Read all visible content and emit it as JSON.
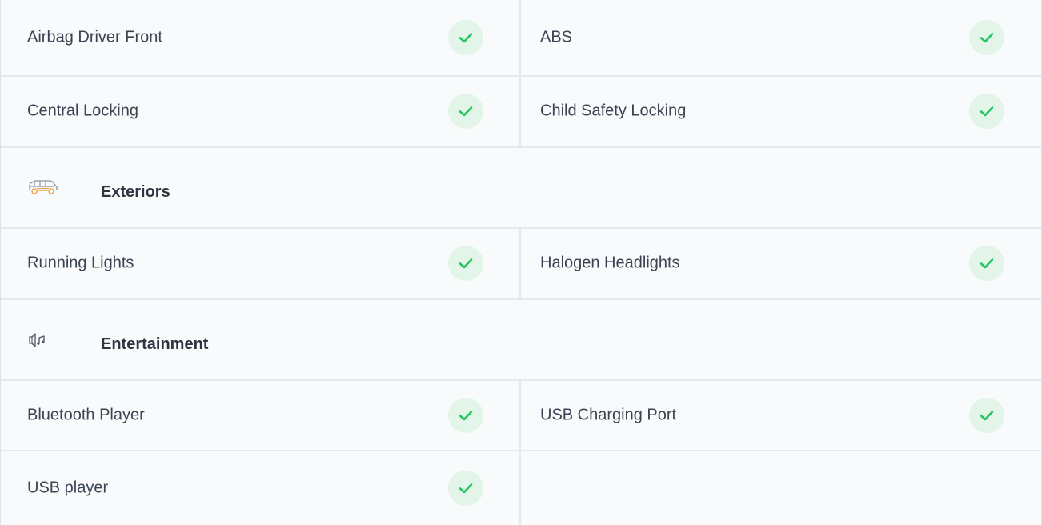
{
  "features": {
    "rows_top": [
      {
        "left": {
          "label": "Airbag Driver Front",
          "status": "check-icon"
        },
        "right": {
          "label": "ABS",
          "status": "check-icon"
        }
      },
      {
        "left": {
          "label": "Central Locking",
          "status": "check-icon"
        },
        "right": {
          "label": "Child Safety Locking",
          "status": "check-icon"
        }
      }
    ],
    "exteriors": {
      "title": "Exteriors",
      "icon": "car-icon",
      "rows": [
        {
          "left": {
            "label": "Running Lights",
            "status": "check-icon"
          },
          "right": {
            "label": "Halogen Headlights",
            "status": "check-icon"
          }
        }
      ]
    },
    "entertainment": {
      "title": "Entertainment",
      "icon": "speaker-music-icon",
      "rows": [
        {
          "left": {
            "label": "Bluetooth Player",
            "status": "check-icon"
          },
          "right": {
            "label": "USB Charging Port",
            "status": "check-icon"
          }
        },
        {
          "left": {
            "label": "USB player",
            "status": "check-icon"
          },
          "right": null
        }
      ]
    }
  },
  "colors": {
    "check_bg": "#e2f5e8",
    "check_mark": "#22c55e",
    "icon_orange": "#f0a44b",
    "icon_grey": "#8a939e",
    "divider": "#e4e9ef",
    "panel_bg": "#f9fafc"
  }
}
